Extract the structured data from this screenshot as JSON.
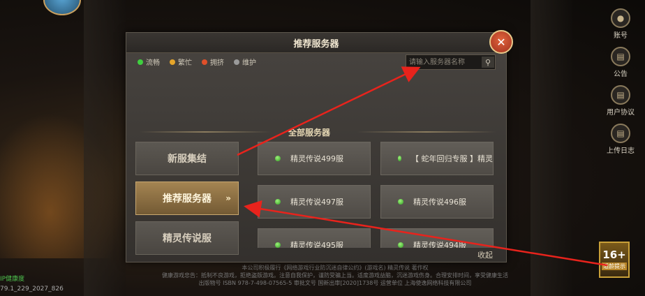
{
  "dialog": {
    "title": "推荐服务器",
    "close_icon": "close-icon",
    "legend": [
      {
        "label": "流畅",
        "color": "#3fcf3f"
      },
      {
        "label": "繁忙",
        "color": "#e5a52a"
      },
      {
        "label": "拥挤",
        "color": "#e0502a"
      },
      {
        "label": "维护",
        "color": "#9a9a9a"
      }
    ],
    "search": {
      "placeholder": "请输入服务器名称",
      "icon": "search-icon"
    },
    "section_title": "全部服务器",
    "categories": [
      {
        "label": "新服集结",
        "active": false
      },
      {
        "label": "推荐服务器",
        "active": true,
        "arrow": "»"
      },
      {
        "label": "精灵传说服",
        "active": false
      }
    ],
    "servers": [
      {
        "name": "精灵传说499服"
      },
      {
        "name": "【 蛇年回归专服 】精灵"
      },
      {
        "name": "精灵传说497服"
      },
      {
        "name": "精灵传说496服"
      },
      {
        "name": "精灵传说495服"
      },
      {
        "name": "精灵传说494服"
      }
    ],
    "collapse_label": "收起"
  },
  "side_menu": [
    {
      "label": "账号",
      "icon": "account-icon"
    },
    {
      "label": "公告",
      "icon": "notice-icon"
    },
    {
      "label": "用户协议",
      "icon": "agreement-icon"
    },
    {
      "label": "上传日志",
      "icon": "upload-log-icon"
    }
  ],
  "age_rating": {
    "value": "16+",
    "label": "适龄提示"
  },
  "bottom_left": {
    "status": "IP健康度",
    "version": "79.1_229_2027_826"
  },
  "legal_lines": [
    "本公司积极履行《网络游戏行业防沉迷自律公约》(游戏名) 精灵传说 著作权",
    "健康游戏忠告：抵制不良游戏，拒绝盗版游戏。注意自我保护，谨防受骗上当。适度游戏益脑，沉迷游戏伤身。合理安排时间，享受健康生活",
    "出版物号 ISBN 978-7-498-07565-5 审批文号 国新出审[2020]1738号 运营单位 上海使逸网络科技有限公司"
  ]
}
